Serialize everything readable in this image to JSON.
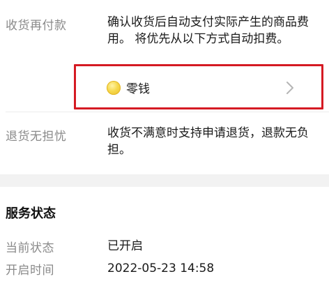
{
  "pay_after_receipt": {
    "label": "收货再付款",
    "description": "确认收货后自动支付实际产生的商品费用。 将优先从以下方式自动扣费。",
    "payment_method": {
      "label": "零钱",
      "icon": "coin-icon"
    }
  },
  "free_returns": {
    "label": "退货无担忧",
    "description": "收货不满意时支持申请退货，退款无负担。"
  },
  "service_status": {
    "title": "服务状态",
    "rows": [
      {
        "label": "当前状态",
        "value": "已开启"
      },
      {
        "label": "开启时间",
        "value": "2022-05-23 14:58"
      }
    ]
  },
  "colors": {
    "highlight_border": "#d51a23",
    "label_gray": "#8a8a8a",
    "coin_yellow": "#f6d84c",
    "section_gap": "#f2f2f2"
  }
}
